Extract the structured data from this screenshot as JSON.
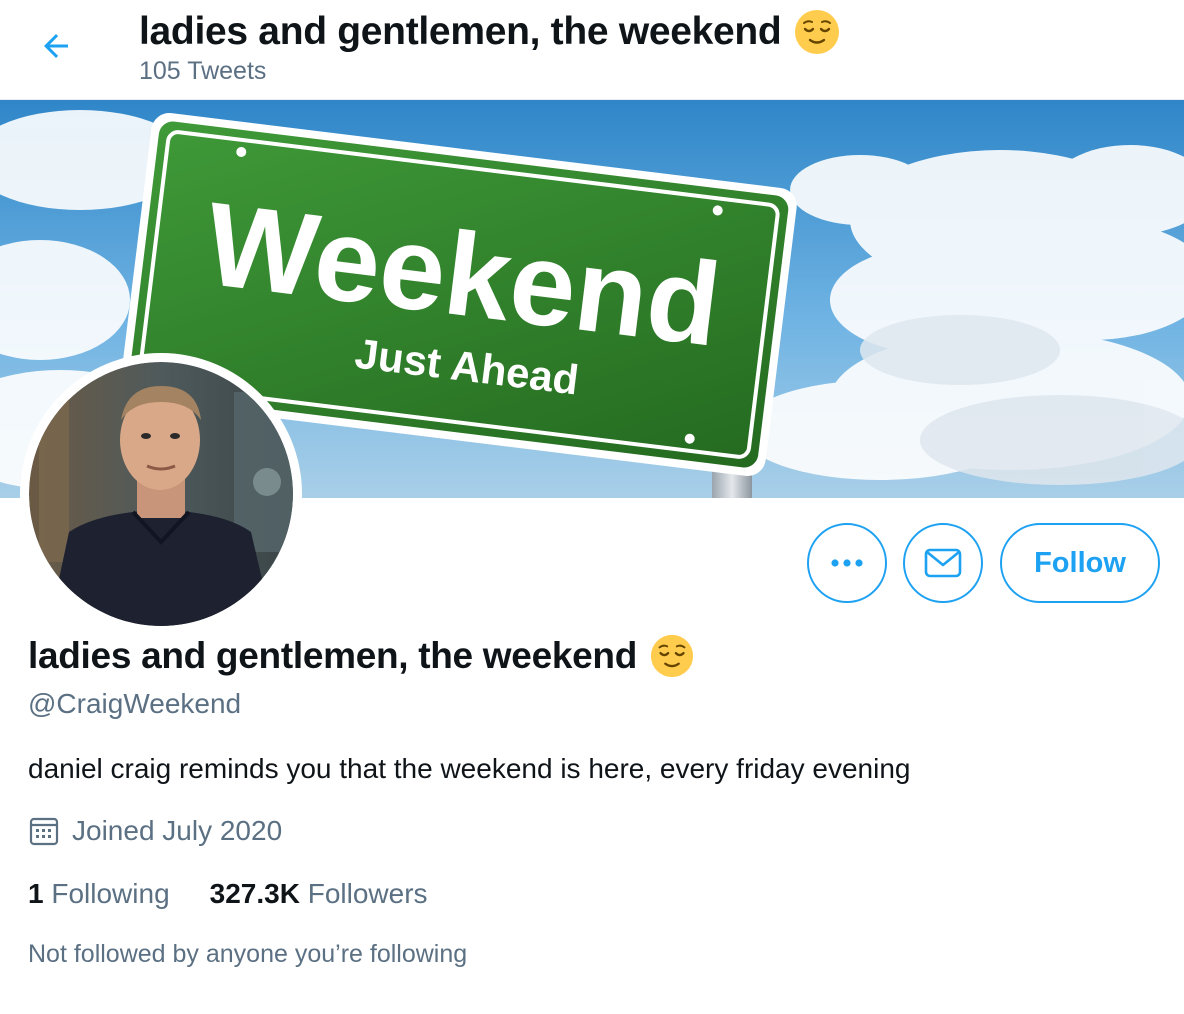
{
  "header": {
    "title": "ladies and gentlemen, the weekend",
    "tweet_count": "105 Tweets",
    "back_icon": "arrow-left-icon",
    "emoji": "relieved-face-emoji"
  },
  "banner": {
    "sign_title": "Weekend",
    "sign_subtitle": "Just Ahead"
  },
  "actions": {
    "more_icon": "more-dots-icon",
    "message_icon": "envelope-icon",
    "follow_label": "Follow"
  },
  "profile": {
    "display_name": "ladies and gentlemen, the weekend",
    "handle": "@CraigWeekend",
    "bio": "daniel craig reminds you that the weekend is here, every friday evening",
    "joined": "Joined July 2020",
    "calendar_icon": "calendar-icon",
    "following_count": "1",
    "following_label": "Following",
    "followers_count": "327.3K",
    "followers_label": "Followers",
    "not_followed": "Not followed by anyone you’re following"
  },
  "colors": {
    "accent": "#1da1f2",
    "secondary_text": "#5b7083",
    "primary_text": "#0f1419",
    "sign_green": "#2f7d2a"
  }
}
